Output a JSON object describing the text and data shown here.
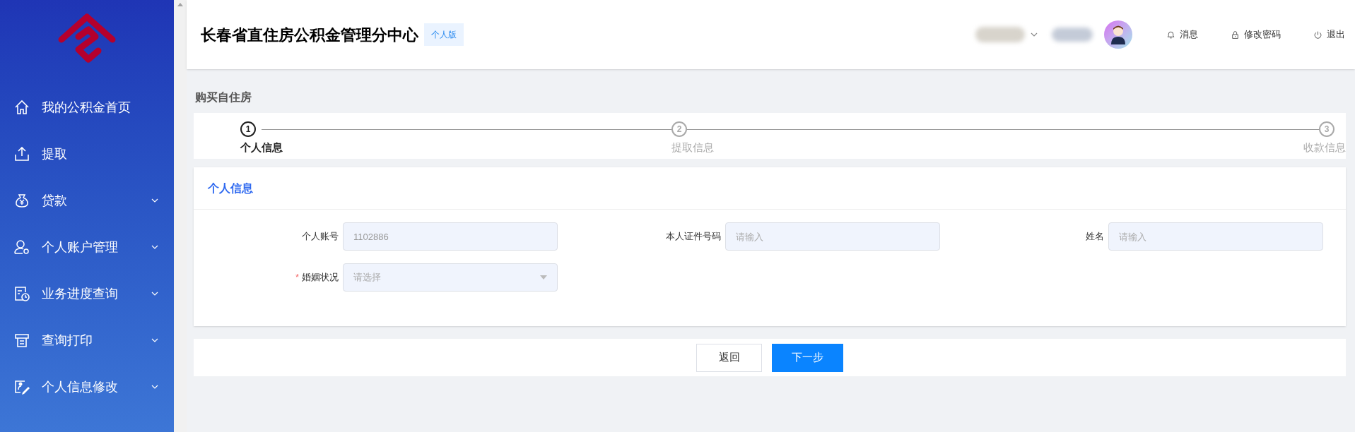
{
  "sidebar": {
    "items": [
      {
        "label": "我的公积金首页",
        "expandable": false
      },
      {
        "label": "提取",
        "expandable": false
      },
      {
        "label": "贷款",
        "expandable": true
      },
      {
        "label": "个人账户管理",
        "expandable": true
      },
      {
        "label": "业务进度查询",
        "expandable": true
      },
      {
        "label": "查询打印",
        "expandable": true
      },
      {
        "label": "个人信息修改",
        "expandable": true
      }
    ]
  },
  "header": {
    "title": "长春省直住房公积金管理分中心",
    "edition_badge": "个人版",
    "actions": [
      {
        "label": "消息"
      },
      {
        "label": "修改密码"
      },
      {
        "label": "退出"
      }
    ]
  },
  "page_title": "购买自住房",
  "steps": [
    {
      "number": "1",
      "label": "个人信息",
      "selected": true
    },
    {
      "number": "2",
      "label": "提取信息",
      "selected": false
    },
    {
      "number": "3",
      "label": "收款信息",
      "selected": false
    }
  ],
  "form": {
    "title": "个人信息",
    "fields": [
      {
        "kind": "input",
        "label": "个人账号",
        "value": "1102886"
      },
      {
        "kind": "input",
        "label": "本人证件号码",
        "placeholder": "请输入"
      },
      {
        "kind": "input",
        "label": "姓名",
        "placeholder": "请输入"
      },
      {
        "kind": "select",
        "label": "婚姻状况",
        "placeholder": "请选择",
        "required_mark": "*"
      }
    ]
  },
  "buttons": [
    {
      "label": "返回",
      "kind": "secondary"
    },
    {
      "label": "下一步",
      "kind": "primary"
    }
  ]
}
